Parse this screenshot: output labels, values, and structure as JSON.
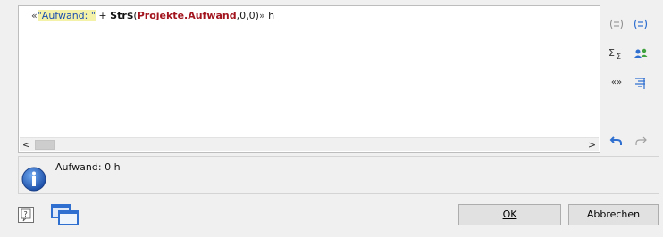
{
  "editor": {
    "formula": {
      "open_quote": "«",
      "string_literal": "\"Aufwand: \"",
      "op": " + ",
      "function": "Str$",
      "paren_open": "(",
      "field": "Projekte.Aufwand",
      "args": ",0,0)",
      "close_quote": "»",
      "suffix": " h"
    },
    "scroll_left": "<",
    "scroll_right": ">"
  },
  "toolbar": {
    "icons": [
      "fields-icon",
      "fields-insert-icon",
      "sum-icon",
      "users-icon",
      "quote-icon",
      "filter-icon",
      "undo-icon",
      "redo-icon"
    ],
    "quote_label": "«»"
  },
  "result": {
    "text": "Aufwand: 0 h",
    "icon": "info-icon"
  },
  "buttons": {
    "ok": "OK",
    "cancel": "Abbrechen"
  },
  "colors": {
    "string": "#1d4fb0",
    "string_bg": "#f3f2a8",
    "field": "#a2141e",
    "accent": "#2f6fd0"
  }
}
